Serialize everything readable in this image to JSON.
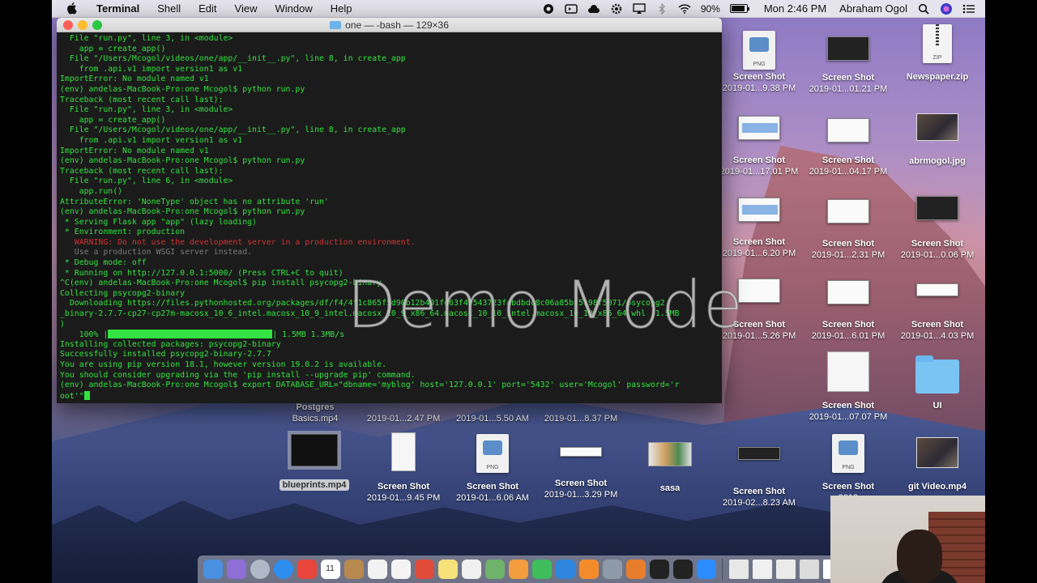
{
  "menubar": {
    "app_name": "Terminal",
    "items": [
      "Shell",
      "Edit",
      "View",
      "Window",
      "Help"
    ],
    "battery": "90%",
    "clock": "Mon 2:46 PM",
    "user": "Abraham Ogol"
  },
  "terminal": {
    "title": "one — -bash — 129×36",
    "lines": [
      {
        "text": "  File \"run.py\", line 3, in <module>",
        "style": "normal"
      },
      {
        "text": "    app = create_app()",
        "style": "normal"
      },
      {
        "text": "  File \"/Users/Mcogol/videos/one/app/__init__.py\", line 8, in create_app",
        "style": "normal"
      },
      {
        "text": "    from .api.v1 import version1 as v1",
        "style": "normal"
      },
      {
        "text": "ImportError: No module named v1",
        "style": "normal"
      },
      {
        "text": "(env) andelas-MacBook-Pro:one Mcogol$ python run.py",
        "style": "normal"
      },
      {
        "text": "Traceback (most recent call last):",
        "style": "normal"
      },
      {
        "text": "  File \"run.py\", line 3, in <module>",
        "style": "normal"
      },
      {
        "text": "    app = create_app()",
        "style": "normal"
      },
      {
        "text": "  File \"/Users/Mcogol/videos/one/app/__init__.py\", line 8, in create_app",
        "style": "normal"
      },
      {
        "text": "    from .api.v1 import version1 as v1",
        "style": "normal"
      },
      {
        "text": "ImportError: No module named v1",
        "style": "normal"
      },
      {
        "text": "(env) andelas-MacBook-Pro:one Mcogol$ python run.py",
        "style": "normal"
      },
      {
        "text": "Traceback (most recent call last):",
        "style": "normal"
      },
      {
        "text": "  File \"run.py\", line 6, in <module>",
        "style": "normal"
      },
      {
        "text": "    app.run()",
        "style": "normal"
      },
      {
        "text": "AttributeError: 'NoneType' object has no attribute 'run'",
        "style": "normal"
      },
      {
        "text": "(env) andelas-MacBook-Pro:one Mcogol$ python run.py",
        "style": "normal"
      },
      {
        "text": " * Serving Flask app \"app\" (lazy loading)",
        "style": "normal"
      },
      {
        "text": " * Environment: production",
        "style": "normal"
      },
      {
        "text": "   WARNING: Do not use the development server in a production environment.",
        "style": "warn"
      },
      {
        "text": "   Use a production WSGI server instead.",
        "style": "dim"
      },
      {
        "text": " * Debug mode: off",
        "style": "normal"
      },
      {
        "text": " * Running on http://127.0.0.1:5000/ (Press CTRL+C to quit)",
        "style": "normal"
      },
      {
        "text": "^C(env) andelas-MacBook-Pro:one Mcogol$ pip install psycopg2-binary",
        "style": "normal"
      },
      {
        "text": "Collecting psycopg2-binary",
        "style": "normal"
      },
      {
        "text": "  Downloading https://files.pythonhosted.org/packages/df/f4/4f1c865f5d90b12b401fd63f49543723fabdbdc8c06a85bf5198f5071/psycopg2",
        "style": "normal"
      },
      {
        "text": "_binary-2.7.7-cp27-cp27m-macosx_10_6_intel.macosx_10_9_intel.macosx_10_9_x86_64.macosx_10_10_intel.macosx_10_10_x86_64.whl (1.5MB",
        "style": "normal"
      },
      {
        "text": ")",
        "style": "normal"
      }
    ],
    "progress": {
      "percent_label": "    100% |",
      "fraction": 1.0,
      "tail": "| 1.5MB 1.3MB/s"
    },
    "lines_after": [
      {
        "text": "Installing collected packages: psycopg2-binary",
        "style": "normal"
      },
      {
        "text": "Successfully installed psycopg2-binary-2.7.7",
        "style": "normal"
      },
      {
        "text": "You are using pip version 18.1, however version 19.0.2 is available.",
        "style": "normal"
      },
      {
        "text": "You should consider upgrading via the 'pip install --upgrade pip' command.",
        "style": "normal"
      },
      {
        "text": "(env) andelas-MacBook-Pro:one Mcogol$ export DATABASE_URL=\"dbname='myblog' host='127.0.0.1' port='5432' user='Mcogol' password='r",
        "style": "normal"
      }
    ],
    "last_line": "oot'\""
  },
  "watermark": "Demo Mode",
  "desktop_icons": {
    "png_1": {
      "name": "Screen Shot",
      "sub": "2019-01...9.38 PM",
      "badge": "PNG"
    },
    "shot_2": {
      "name": "Screen Shot",
      "sub": "2019-01...01.21 PM"
    },
    "zip": {
      "name": "Newspaper.zip",
      "badge": "ZIP"
    },
    "shot_3": {
      "name": "Screen Shot",
      "sub": "2019-01...17.01 PM"
    },
    "shot_4": {
      "name": "Screen Shot",
      "sub": "2019-01...04.17 PM"
    },
    "photo": {
      "name": "abrmogol.jpg"
    },
    "shot_5": {
      "name": "Screen Shot",
      "sub": "2019-01...6.20 PM"
    },
    "shot_6": {
      "name": "Screen Shot",
      "sub": "2019-01...2.31 PM"
    },
    "shot_7": {
      "name": "Screen Shot",
      "sub": "2019-01...0.06 PM"
    },
    "shot_8": {
      "name": "Screen Shot",
      "sub": "2019-01...5.26 PM"
    },
    "shot_9": {
      "name": "Screen Shot",
      "sub": "2019-01...6.01 PM"
    },
    "shot_10": {
      "name": "Screen Shot",
      "sub": "2019-01...4.03 PM"
    },
    "shot_11": {
      "name": "Screen Shot",
      "sub": "2019-01...07.07 PM"
    },
    "folder_ui": {
      "name": "UI"
    },
    "postgres": {
      "name": "Postgres",
      "sub": "Basics.mp4"
    },
    "shot_12": {
      "sub": "2019-01...2.47 PM"
    },
    "shot_13": {
      "sub": "2019-01...5.50 AM"
    },
    "shot_14": {
      "sub": "2019-01...8.37 PM"
    },
    "blueprints": {
      "name": "blueprints.mp4"
    },
    "shot_15": {
      "name": "Screen Shot",
      "sub": "2019-01...9.45 PM"
    },
    "png_16": {
      "name": "Screen Shot",
      "sub": "2019-01...6.06 AM",
      "badge": "PNG"
    },
    "shot_17": {
      "name": "Screen Shot",
      "sub": "2019-01...3.29 PM"
    },
    "sasa": {
      "name": "sasa"
    },
    "shot_18": {
      "name": "Screen Shot",
      "sub": "2019-02...8.23 AM"
    },
    "png_19": {
      "name": "Screen Shot",
      "sub": "2019",
      "badge": "PNG"
    },
    "git_video": {
      "name": "git Video.mp4"
    }
  },
  "dock": {
    "colors": [
      "#4a8fe0",
      "#8d6fd6",
      "#b0b8c8",
      "#2d8ef0",
      "#e8453c",
      "#4d7fd9",
      "#b8894e",
      "#f2f2f2",
      "#f4f4f4",
      "#e04b3a",
      "#f6e17a",
      "#f0f0f0",
      "#6fb36a",
      "#f39c3d",
      "#3fbd5c",
      "#2e86de",
      "#f48c2c",
      "#8f9aa8",
      "#e87e2c",
      "#222222",
      "#222222",
      "#2d8cff"
    ],
    "right_colors": [
      "#e8e8e8",
      "#f0f0f0",
      "#eaeaea",
      "#dcdcdc",
      "#ffffff",
      "#d9d9d9",
      "#cfcfcf"
    ],
    "calendar_day": "11"
  }
}
